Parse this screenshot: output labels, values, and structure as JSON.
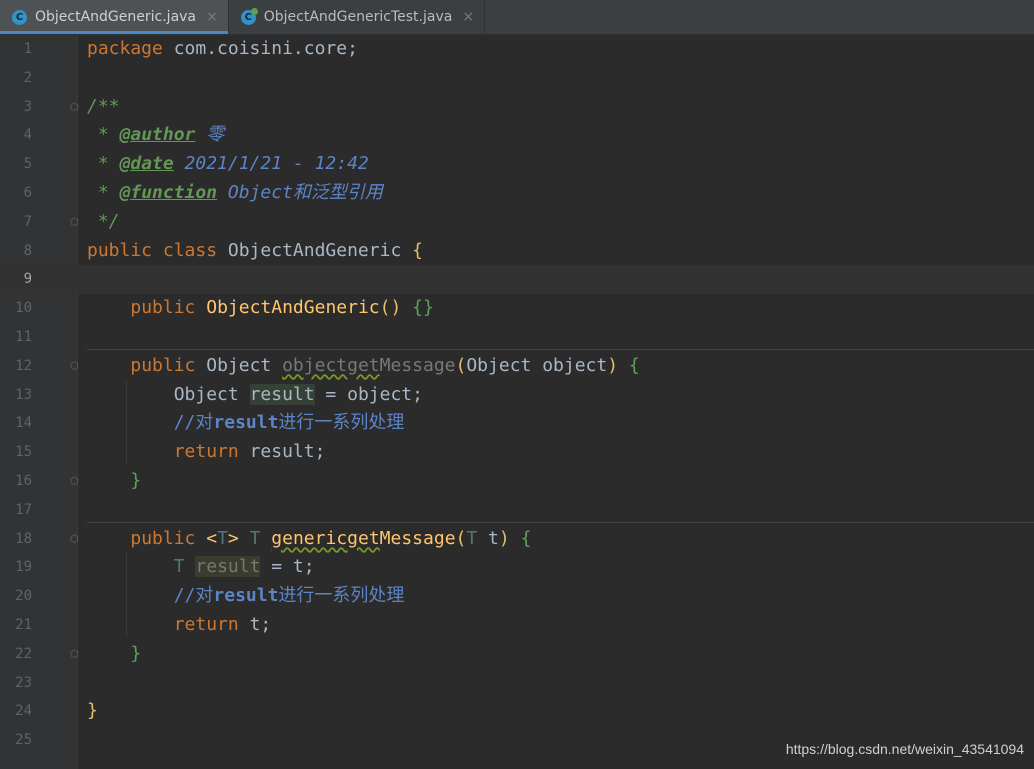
{
  "tabs": [
    {
      "label": "ObjectAndGeneric.java",
      "icon": "java-class-icon",
      "active": true
    },
    {
      "label": "ObjectAndGenericTest.java",
      "icon": "java-test-class-icon",
      "active": false
    }
  ],
  "lines": [
    "1",
    "2",
    "3",
    "4",
    "5",
    "6",
    "7",
    "8",
    "9",
    "10",
    "11",
    "12",
    "13",
    "14",
    "15",
    "16",
    "17",
    "18",
    "19",
    "20",
    "21",
    "22",
    "23",
    "24",
    "25"
  ],
  "code": {
    "l1_kw": "package",
    "l1_pkg": " com.coisini.core;",
    "l3": "/**",
    "l4_star": " * ",
    "l4_tag": "@author",
    "l4_val": " 零",
    "l5_star": " * ",
    "l5_tag": "@date",
    "l5_val": " 2021/1/21 - 12:42",
    "l6_star": " * ",
    "l6_tag": "@function",
    "l6_val": " Object和泛型引用",
    "l7": " */",
    "l8_kw": "public class",
    "l8_name": " ObjectAndGeneric ",
    "l8_brace": "{",
    "l10_kw": "public",
    "l10_name": "ObjectAndGeneric",
    "l10_paren": "()",
    "l10_body": "{}",
    "l12_kw": "public",
    "l12_type": " Object ",
    "l12_name_gray": "objectget",
    "l12_name_rest": "Message",
    "l12_p1": "(",
    "l12_params": "Object object",
    "l12_p2": ")",
    "l12_brace": "{",
    "l13_type": "Object ",
    "l13_var": "result",
    "l13_rest": " = object;",
    "l14_cm1": "//对",
    "l14_cmb": "result",
    "l14_cm2": "进行一系列处理",
    "l15_kw": "return",
    "l15_rest": " result;",
    "l16": "}",
    "l18_kw": "public",
    "l18_lt": "<",
    "l18_t": "T",
    "l18_gt": ">",
    "l18_t2": "T",
    "l18_name1": "genericget",
    "l18_name2": "Message",
    "l18_p1": "(",
    "l18_t3": "T",
    "l18_arg": " t",
    "l18_p2": ")",
    "l18_brace": "{",
    "l19_t": "T",
    "l19_var": "result",
    "l19_rest": " = t;",
    "l20_cm1": "//对",
    "l20_cmb": "result",
    "l20_cm2": "进行一系列处理",
    "l21_kw": "return",
    "l21_rest": " t;",
    "l22": "}",
    "l24": "}"
  },
  "watermark": "https://blog.csdn.net/weixin_43541094",
  "colors": {
    "background": "#2b2b2b",
    "keyword": "#cc7832",
    "method": "#ffc66d",
    "doc_comment": "#629755",
    "comment": "#5c84c6",
    "type_param": "#507874",
    "tab_accent": "#4a88c7"
  }
}
